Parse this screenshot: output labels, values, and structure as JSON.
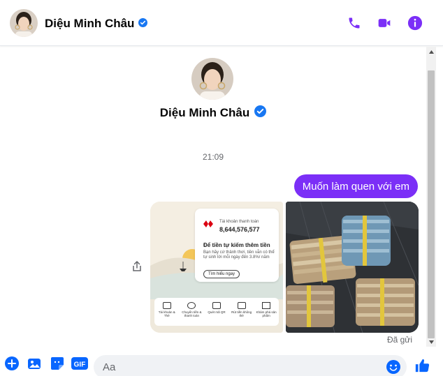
{
  "contact": {
    "name": "Diệu Minh Châu",
    "verified": true
  },
  "header": {
    "icons": [
      "phone-icon",
      "video-camera-icon",
      "info-icon"
    ]
  },
  "conversation": {
    "timestamp": "21:09",
    "outgoing_message": "Muốn làm quen với em",
    "seen_status": "Đã gửi",
    "attachments": [
      {
        "kind": "bank-app-screenshot",
        "account_label": "Tài khoản thanh toán",
        "account_number": "8,644,576,577",
        "promo_title": "Để tiền tự kiếm thêm tiền",
        "promo_desc": "Bạn hãy cứ thảnh thơi, tiền vẫn có thể tự sinh lời mỗi ngày đến 3.8%/ năm",
        "promo_button": "Tìm hiểu ngay",
        "actions": [
          "Tài khoản & Thẻ",
          "Chuyển tiền & thanh toán",
          "Quét mã QR",
          "Rút tiền không thẻ",
          "Khám phá sản phẩm"
        ]
      },
      {
        "kind": "cash-bundles-photo"
      }
    ]
  },
  "composer": {
    "placeholder": "Aa",
    "icons": [
      "plus-icon",
      "image-icon",
      "sticker-icon",
      "gif-icon",
      "emoji-icon",
      "thumbs-up-icon"
    ],
    "gif_label": "GIF"
  },
  "colors": {
    "accent": "#7b2ff7",
    "messenger_blue": "#0866ff",
    "verified_blue": "#1877f2"
  }
}
